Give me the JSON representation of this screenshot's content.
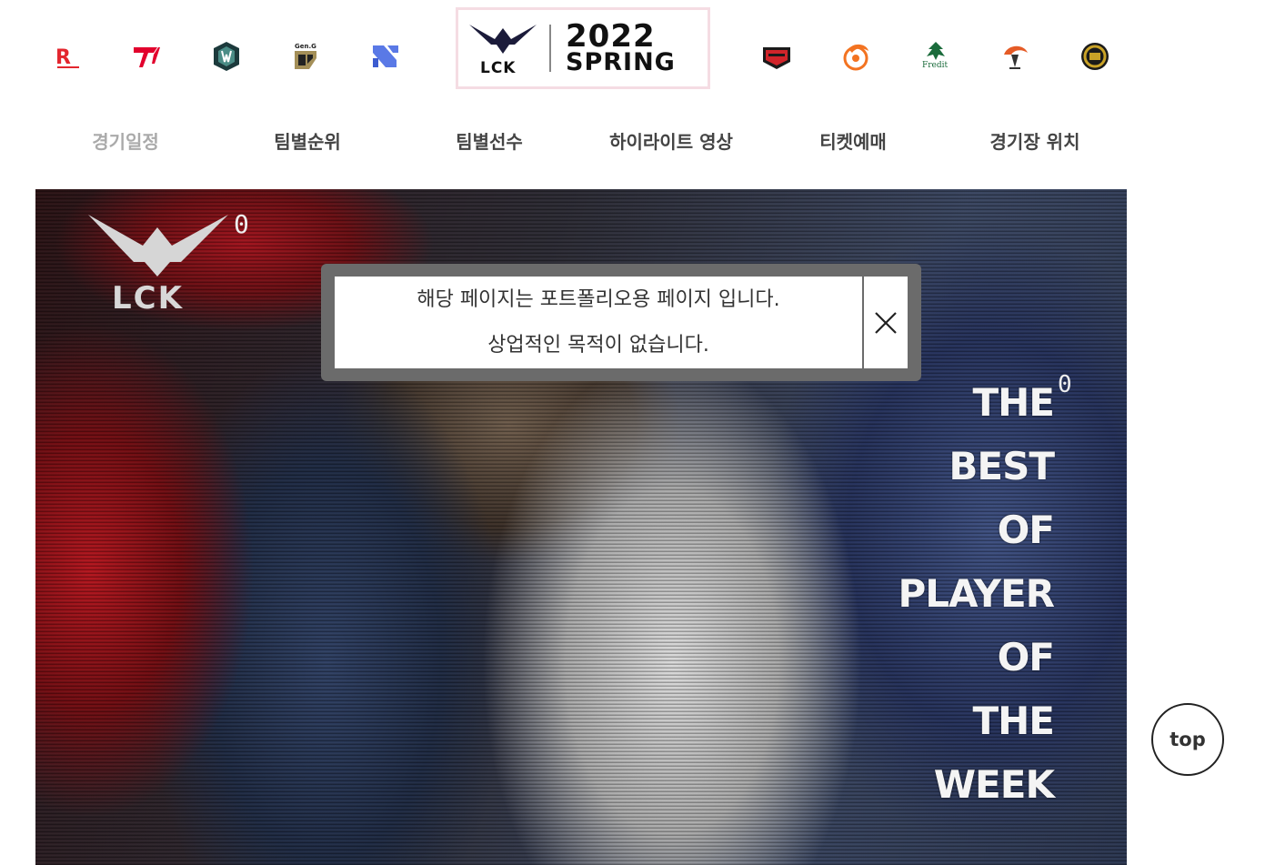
{
  "header": {
    "teams_left": [
      {
        "icon": "kt-rolster-logo-icon",
        "color": "#e3262e"
      },
      {
        "icon": "t1-logo-icon",
        "color": "#e2012d"
      },
      {
        "icon": "dwg-kia-logo-icon",
        "color": "#1c3a3c"
      },
      {
        "icon": "gen-g-logo-icon",
        "color": "#a48f58"
      },
      {
        "icon": "drx-logo-icon",
        "color": "#5a79e6"
      }
    ],
    "teams_right": [
      {
        "icon": "nongshim-redforce-logo-icon",
        "color": "#d1242a"
      },
      {
        "icon": "hanwha-life-logo-icon",
        "color": "#f37321"
      },
      {
        "icon": "fredit-brion-logo-icon",
        "color": "#1a6b3b"
      },
      {
        "icon": "kwangdong-freecs-logo-icon",
        "color": "#e55b26"
      },
      {
        "icon": "liiv-sandbox-logo-icon",
        "color": "#c9a227"
      }
    ],
    "main_logo": {
      "icon": "lck-logo-icon",
      "brand": "LCK",
      "year": "2022",
      "season": "SPRING"
    }
  },
  "nav": {
    "items": [
      {
        "label": "경기일정",
        "active": true
      },
      {
        "label": "팀별순위",
        "active": false
      },
      {
        "label": "팀별선수",
        "active": false
      },
      {
        "label": "하이라이트 영상",
        "active": false
      },
      {
        "label": "티켓예매",
        "active": false
      },
      {
        "label": "경기장 위치",
        "active": false
      }
    ]
  },
  "hero": {
    "brand": "LCK",
    "counter_top": "0",
    "counter_tagline": "0",
    "tagline": [
      "THE",
      "BEST",
      "OF",
      "PLAYER",
      "OF",
      "THE",
      "WEEK"
    ]
  },
  "notice": {
    "line1": "해당 페이지는 포트폴리오용 페이지 입니다.",
    "line2": "상업적인 목적이 없습니다.",
    "close_icon": "close-icon"
  },
  "top_button": {
    "label": "top"
  },
  "colors": {
    "accent_border": "#f5dce3",
    "notice_frame": "#6b6b6b",
    "nav_active": "#aaaaaa",
    "nav_default": "#444444"
  }
}
